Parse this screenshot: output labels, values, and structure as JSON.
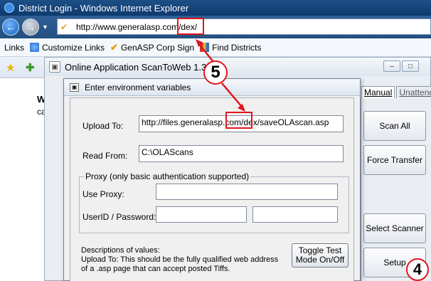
{
  "browser": {
    "title": "District Login - Windows Internet Explorer",
    "address": "http://www.generalasp.com/dex/",
    "links_bar": [
      {
        "label": "Links",
        "icon": ""
      },
      {
        "label": "Customize Links",
        "icon": "ie-page-icon"
      },
      {
        "label": "GenASP Corp Sign",
        "icon": "genasp-v-icon"
      },
      {
        "label": "Find Districts",
        "icon": "find-districts-icon"
      }
    ]
  },
  "page": {
    "heading_fragment": "W",
    "text_fragment": "ca"
  },
  "stw_window": {
    "title": "Online Application ScanToWeb 1.3",
    "tabs": [
      "Manual",
      "Unattende"
    ],
    "buttons": {
      "scan_all": "Scan All",
      "force_transfer": "Force Transfer",
      "select_scanner": "Select Scanner",
      "setup": "Setup"
    }
  },
  "dialog": {
    "title": "Enter environment variables",
    "upload_to_label": "Upload To:",
    "upload_to_value": "http://files.generalasp.com/dex/saveOLAscan.asp",
    "read_from_label": "Read From:",
    "read_from_value": "C:\\OLAScans",
    "proxy_group": "Proxy (only basic authentication supported)",
    "use_proxy_label": "Use Proxy:",
    "use_proxy_value": "",
    "userid_label": "UserID / Password:",
    "userid_value": "",
    "password_value": "",
    "toggle_button": "Toggle Test Mode On/Off",
    "desc_line1": "Descriptions of values:",
    "desc_line2": "Upload To: This should be the fully qualified web address",
    "desc_line3": "of a .asp page that can accept posted Tiffs."
  },
  "callouts": {
    "step5": "5",
    "step4": "4",
    "highlight_color": "#e0161f"
  }
}
